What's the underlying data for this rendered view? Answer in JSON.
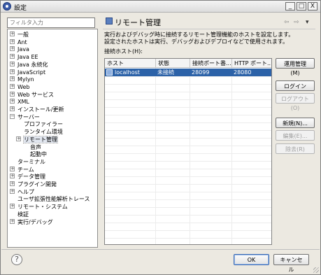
{
  "window": {
    "title": "設定"
  },
  "window_controls": {
    "minimize": "_",
    "maximize": "□",
    "close": "X"
  },
  "filter": {
    "placeholder": "フィルタ入力"
  },
  "tree": {
    "items": [
      {
        "label": "一般",
        "expander": "+"
      },
      {
        "label": "Ant",
        "expander": "+"
      },
      {
        "label": "Java",
        "expander": "+"
      },
      {
        "label": "Java EE",
        "expander": "+"
      },
      {
        "label": "Java 永続化",
        "expander": "+"
      },
      {
        "label": "JavaScript",
        "expander": "+"
      },
      {
        "label": "Mylyn",
        "expander": "+"
      },
      {
        "label": "Web",
        "expander": "+"
      },
      {
        "label": "Web サービス",
        "expander": "+"
      },
      {
        "label": "XML",
        "expander": "+"
      },
      {
        "label": "インストール/更新",
        "expander": "+"
      },
      {
        "label": "サーバー",
        "expander": "−"
      },
      {
        "label": "プロファイラー",
        "expander": ""
      },
      {
        "label": "ランタイム環境",
        "expander": ""
      },
      {
        "label": "リモート管理",
        "expander": "+"
      },
      {
        "label": "音声",
        "expander": ""
      },
      {
        "label": "起動中",
        "expander": ""
      },
      {
        "label": "ターミナル",
        "expander": ""
      },
      {
        "label": "チーム",
        "expander": "+"
      },
      {
        "label": "データ管理",
        "expander": "+"
      },
      {
        "label": "プラグイン開発",
        "expander": "+"
      },
      {
        "label": "ヘルプ",
        "expander": "+"
      },
      {
        "label": "ユーザ拡張性能解析トレース",
        "expander": ""
      },
      {
        "label": "リモート・システム",
        "expander": "+"
      },
      {
        "label": "検証",
        "expander": ""
      },
      {
        "label": "実行/デバッグ",
        "expander": "+"
      }
    ]
  },
  "page": {
    "title": "リモート管理",
    "nav_back": "⇦",
    "nav_forward": "⇨",
    "nav_menu": "▾",
    "description_line1": "実行およびデバッグ時に接続するリモート管理機能のホストを設定します。",
    "description_line2": "設定されたホストは実行、デバッグおよびデプロイなどで使用されます。",
    "hosts_label": "接続ホスト(H):"
  },
  "table": {
    "columns": [
      "ホスト",
      "状態",
      "接続ポート番...",
      "HTTP ポート..."
    ],
    "rows": [
      {
        "host": "localhost",
        "status": "未接続",
        "connect_port": "28099",
        "http_port": "28080"
      }
    ]
  },
  "buttons": {
    "manage": "運用管理(M)",
    "login": "ログイン(I)...",
    "logout": "ログアウト(O)",
    "new": "新規(N)...",
    "edit": "編集(E)...",
    "remove": "除去(R)"
  },
  "footer": {
    "help": "?",
    "ok": "OK",
    "cancel": "キャンセル"
  }
}
